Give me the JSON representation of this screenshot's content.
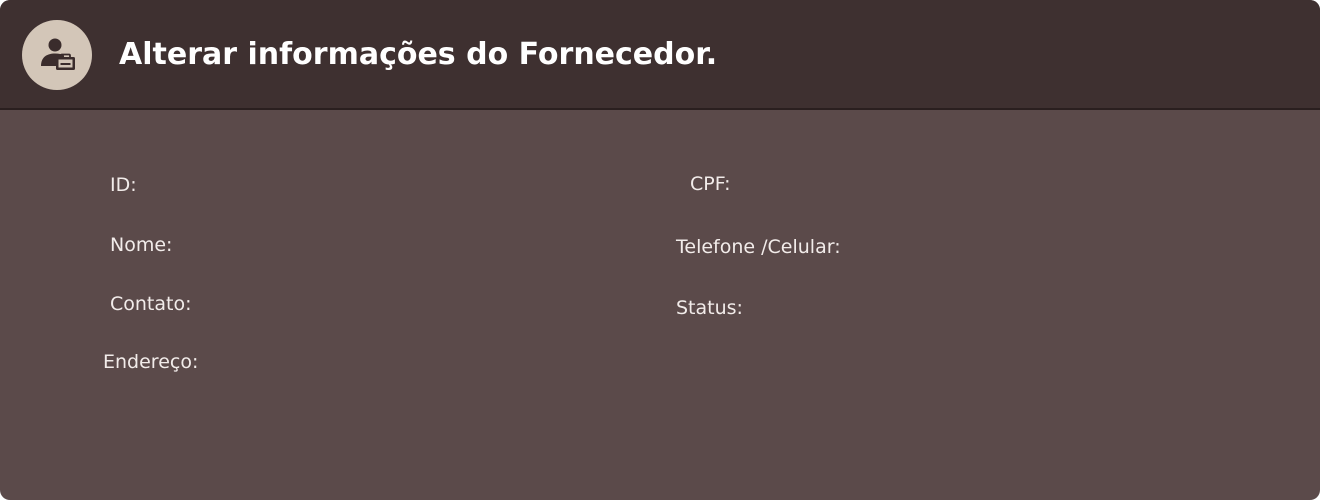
{
  "header": {
    "title": "Alterar informações do Fornecedor.",
    "icon": "supplier-user-icon"
  },
  "form": {
    "left_labels": {
      "id": "ID:",
      "nome": "Nome:",
      "contato": "Contato:",
      "endereco": "Endereço:"
    },
    "right_labels": {
      "cpf": "CPF:",
      "telefone": "Telefone /Celular:",
      "status": "Status:"
    }
  },
  "colors": {
    "header_bg": "#3e3030",
    "body_bg": "#5b4a4a",
    "avatar_bg": "#d3c6b8",
    "icon_color": "#3a2c2c",
    "text": "#ffffff"
  }
}
